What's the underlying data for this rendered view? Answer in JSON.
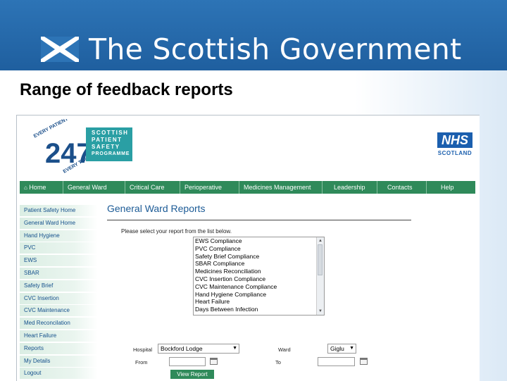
{
  "banner": {
    "title": "The Scottish Government",
    "bg_color": "#2d74b6"
  },
  "slide": {
    "title": "Range of feedback reports"
  },
  "logo": {
    "every_patient": "EVERY PATIENT",
    "number": "247",
    "every_time": "EVERY TIME",
    "programme": [
      "SCOTTISH",
      "PATIENT",
      "SAFETY",
      "PROGRAMME"
    ]
  },
  "nhs": {
    "badge": "NHS",
    "sub": "SCOTLAND"
  },
  "nav": {
    "items": [
      "Home",
      "General Ward",
      "Critical Care",
      "Perioperative",
      "Medicines Management",
      "Leadership",
      "Contacts",
      "Help"
    ],
    "color": "#2f8a5a"
  },
  "sidebar": {
    "items": [
      "Patient Safety Home",
      "General Ward Home",
      "Hand Hygiene",
      "PVC",
      "EWS",
      "SBAR",
      "Safety Brief",
      "CVC Insertion",
      "CVC Maintenance",
      "Med Reconcilation",
      "Heart Failure",
      "Reports",
      "My Details",
      "Logout"
    ]
  },
  "content": {
    "title": "General Ward Reports",
    "prompt": "Please select your report from the list below.",
    "reports": [
      "EWS Compliance",
      "PVC Compliance",
      "Safety Brief Compliance",
      "SBAR Compliance",
      "Medicines Reconciliation",
      "CVC Insertion Compliance",
      "CVC Maintenance Compliance",
      "Hand Hygiene Compliance",
      "Heart Failure",
      "Days Between Infection"
    ]
  },
  "form": {
    "hospital_label": "Hospital",
    "hospital_value": "Bockford Lodge",
    "ward_label": "Ward",
    "ward_value": "Giglu",
    "from_label": "From",
    "to_label": "To",
    "view_button": "View Report"
  }
}
